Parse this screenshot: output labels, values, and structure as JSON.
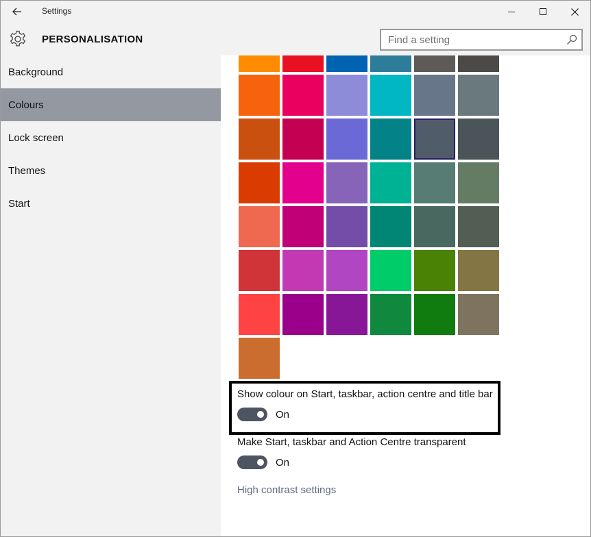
{
  "window": {
    "title": "Settings"
  },
  "header": {
    "section_title": "PERSONALISATION",
    "search_placeholder": "Find a setting"
  },
  "sidebar": {
    "items": [
      {
        "label": "Background",
        "active": false
      },
      {
        "label": "Colours",
        "active": true
      },
      {
        "label": "Lock screen",
        "active": false
      },
      {
        "label": "Themes",
        "active": false
      },
      {
        "label": "Start",
        "active": false
      }
    ]
  },
  "colour_grid": {
    "selected": "#515c6b",
    "rows": [
      [
        "#ff8c00",
        "#e81123",
        "#0063b1",
        "#2d7d9a",
        "#5d5a58",
        "#4c4a48"
      ],
      [
        "#f7630c",
        "#ea005e",
        "#8e8cd8",
        "#00b7c3",
        "#68768a",
        "#69797e"
      ],
      [
        "#ca5010",
        "#c30052",
        "#6b69d6",
        "#038387",
        "#515c6b",
        "#4a5459"
      ],
      [
        "#da3b01",
        "#e3008c",
        "#8764b8",
        "#00b294",
        "#567c73",
        "#647c64"
      ],
      [
        "#ef6950",
        "#bf0077",
        "#744da9",
        "#018574",
        "#486860",
        "#525e54"
      ],
      [
        "#d13438",
        "#c239b3",
        "#b146c2",
        "#00cc6a",
        "#498205",
        "#847545"
      ],
      [
        "#ff4343",
        "#9a0089",
        "#881798",
        "#10893e",
        "#107c10",
        "#7e735f"
      ],
      [
        "#ca6d2f"
      ]
    ]
  },
  "settings": {
    "show_colour": {
      "label": "Show colour on Start, taskbar, action centre and title bar",
      "state": "On"
    },
    "transparent": {
      "label": "Make Start, taskbar and Action Centre transparent",
      "state": "On"
    },
    "high_contrast_link": "High contrast settings"
  },
  "colors": {
    "accent": "#4d5563",
    "sidebar_active": "#9398a1",
    "chrome": "#f2f2f2"
  }
}
